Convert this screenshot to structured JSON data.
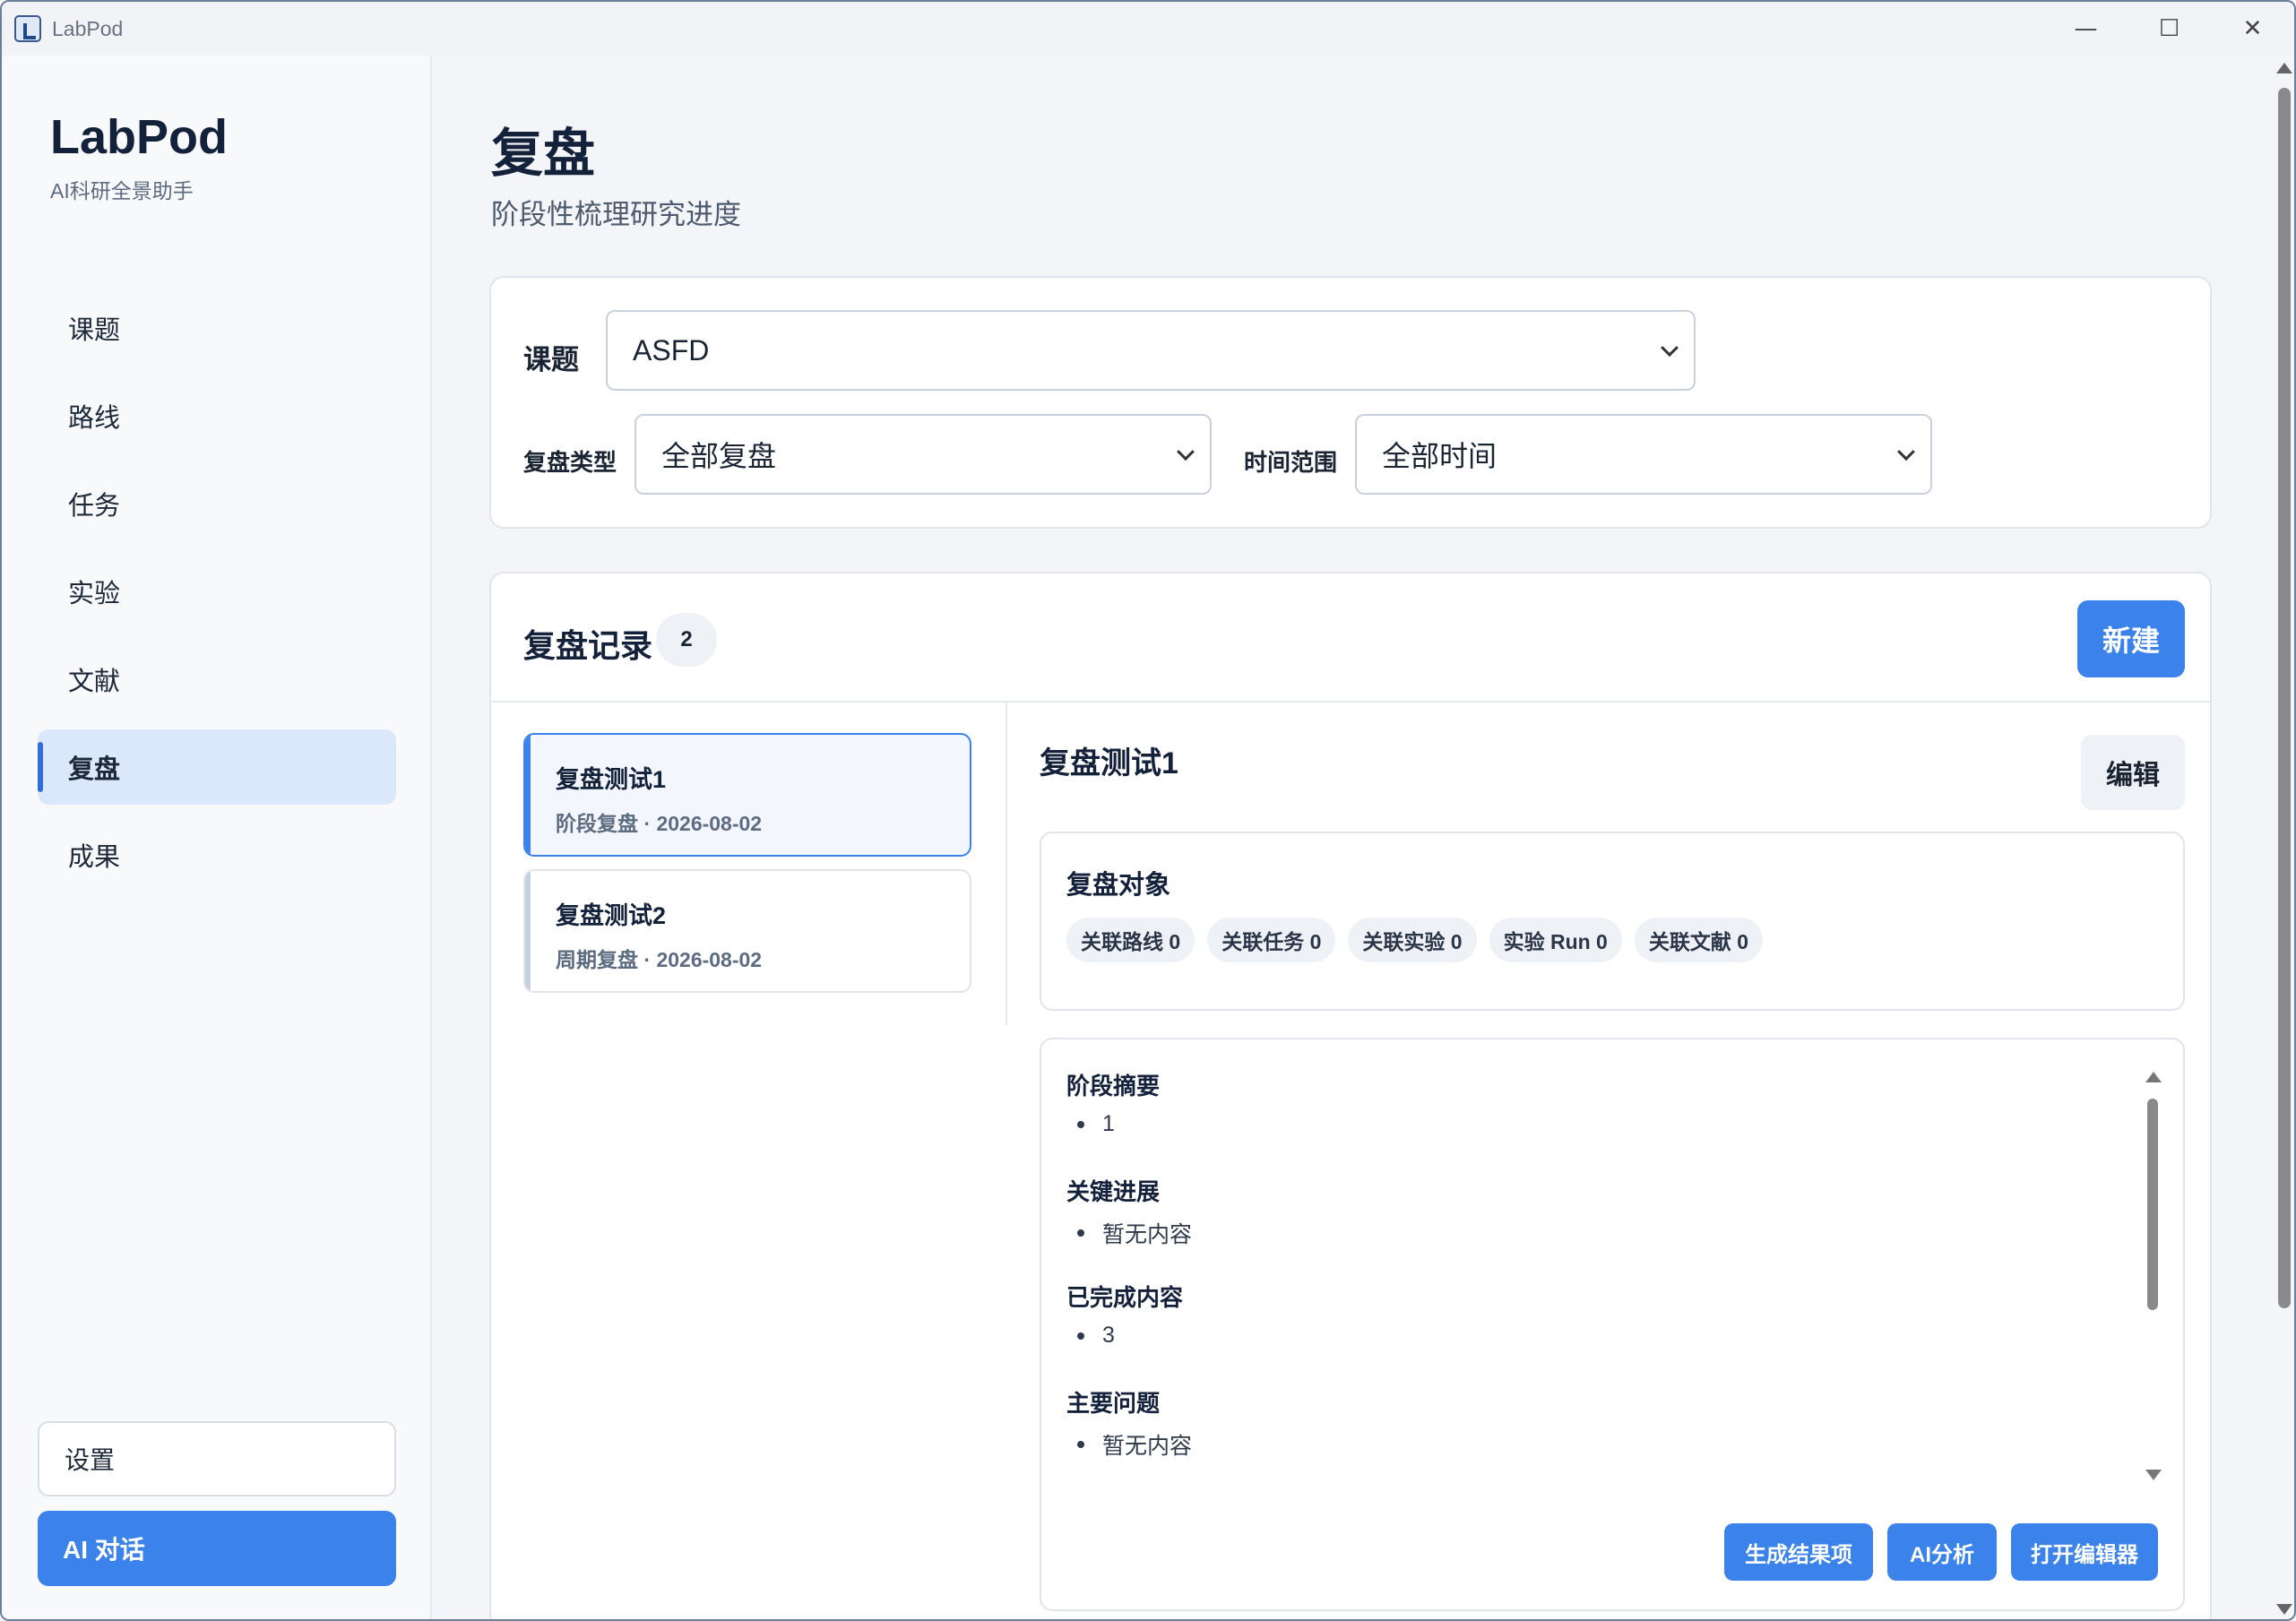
{
  "window": {
    "title": "LabPod",
    "controls": {
      "minimize": "—",
      "maximize": "☐",
      "close": "✕"
    }
  },
  "sidebar": {
    "brand": "LabPod",
    "tagline": "AI科研全景助手",
    "items": [
      {
        "label": "课题",
        "active": false
      },
      {
        "label": "路线",
        "active": false
      },
      {
        "label": "任务",
        "active": false
      },
      {
        "label": "实验",
        "active": false
      },
      {
        "label": "文献",
        "active": false
      },
      {
        "label": "复盘",
        "active": true
      },
      {
        "label": "成果",
        "active": false
      }
    ],
    "settings_label": "设置",
    "ai_chat_label": "AI 对话"
  },
  "header": {
    "title": "复盘",
    "subtitle": "阶段性梳理研究进度"
  },
  "filters": {
    "topic_label": "课题",
    "topic_value": "ASFD",
    "type_label": "复盘类型",
    "type_value": "全部复盘",
    "range_label": "时间范围",
    "range_value": "全部时间"
  },
  "records": {
    "title": "复盘记录",
    "count": "2",
    "new_label": "新建",
    "items": [
      {
        "name": "复盘测试1",
        "meta": "阶段复盘 · 2026-08-02",
        "active": true
      },
      {
        "name": "复盘测试2",
        "meta": "周期复盘 · 2026-08-02",
        "active": false
      }
    ]
  },
  "detail": {
    "title": "复盘测试1",
    "edit_label": "编辑",
    "objects_title": "复盘对象",
    "chips": [
      "关联路线 0",
      "关联任务 0",
      "关联实验 0",
      "实验 Run 0",
      "关联文献 0"
    ],
    "sections": [
      {
        "heading": "阶段摘要",
        "bullet": "1"
      },
      {
        "heading": "关键进展",
        "bullet": "暂无内容"
      },
      {
        "heading": "已完成内容",
        "bullet": "3"
      },
      {
        "heading": "主要问题",
        "bullet": "暂无内容"
      }
    ],
    "actions": {
      "generate": "生成结果项",
      "ai_analysis": "AI分析",
      "open_editor": "打开编辑器"
    }
  }
}
